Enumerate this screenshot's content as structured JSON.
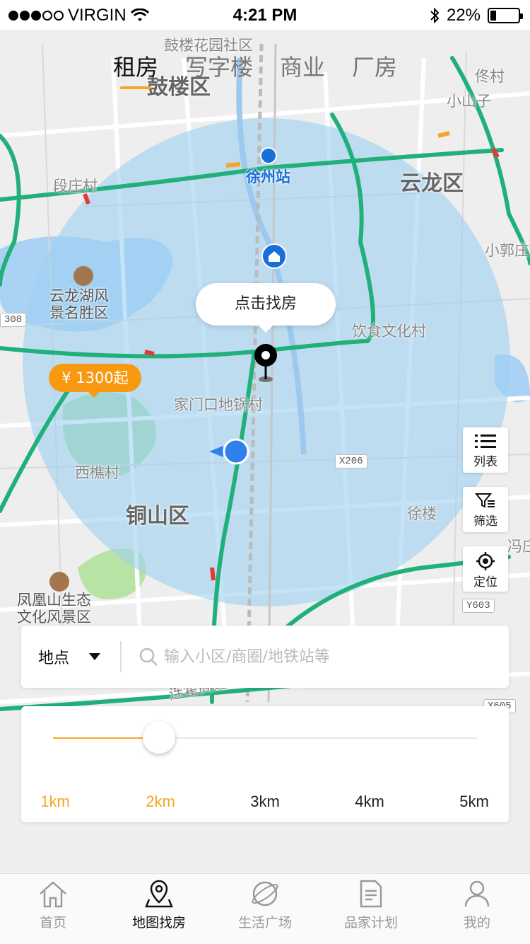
{
  "status_bar": {
    "carrier": "VIRGIN",
    "time": "4:21 PM",
    "battery": "22%",
    "battery_level": 0.22,
    "signal_bars": 3
  },
  "top_tabs": [
    {
      "label": "租房",
      "active": true
    },
    {
      "label": "写字楼",
      "active": false
    },
    {
      "label": "商业",
      "active": false
    },
    {
      "label": "厂房",
      "active": false
    }
  ],
  "map": {
    "labels": {
      "gulou_garden": "鼓楼花园社区",
      "gulou": "鼓楼区",
      "tongcun": "佟村",
      "xiaoshanzi": "小山子",
      "duanzhuang": "段庄村",
      "xuzhou_station": "徐州站",
      "yunlong": "云龙区",
      "xiaoguozhuang": "小郭庄",
      "yunlong_lake": "云龙湖风\n景名胜区",
      "yinshi": "饮食文化村",
      "jiamenkou": "家门口地锅村",
      "xiqiao": "西樵村",
      "tongshan": "铜山区",
      "xulou": "徐楼",
      "feng": "冯庄",
      "fenghuang": "凤凰山生态\n文化风景区",
      "lianhuo": "连霍高速",
      "code_308": "308",
      "code_x206": "X206",
      "code_y603": "Y603",
      "code_x605": "X605"
    },
    "bubble": "点击找房",
    "price_tag": "¥ 1300起"
  },
  "side_buttons": {
    "list": "列表",
    "filter": "筛选",
    "locate": "定位"
  },
  "search": {
    "location_label": "地点",
    "placeholder": "输入小区/商圈/地铁站等"
  },
  "radius": {
    "options": [
      "1km",
      "2km",
      "3km",
      "4km",
      "5km"
    ],
    "selected": "2km",
    "selected_fraction": 0.25,
    "colors": {
      "accent": "#f5a623"
    }
  },
  "bottom_nav": [
    {
      "label": "首页",
      "icon": "home-icon",
      "active": false
    },
    {
      "label": "地图找房",
      "icon": "map-pin-icon",
      "active": true
    },
    {
      "label": "生活广场",
      "icon": "planet-icon",
      "active": false
    },
    {
      "label": "品家计划",
      "icon": "document-icon",
      "active": false
    },
    {
      "label": "我的",
      "icon": "user-icon",
      "active": false
    }
  ]
}
